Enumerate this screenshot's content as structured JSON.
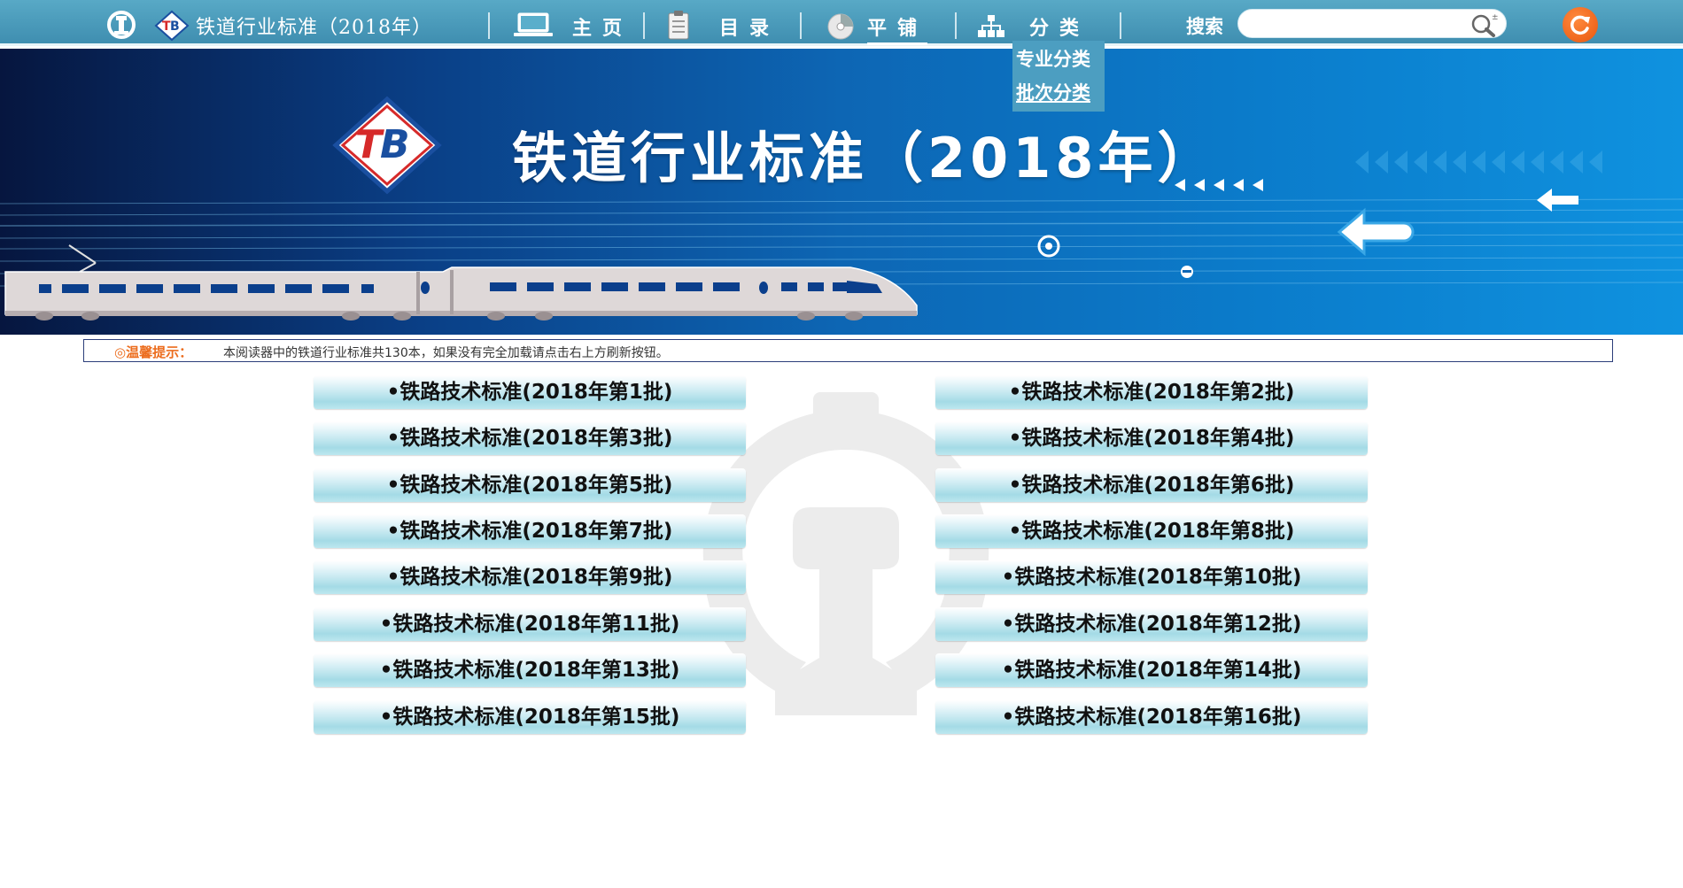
{
  "header": {
    "title": "铁道行业标准（2018年）",
    "nav": [
      {
        "label": "主页",
        "icon": "laptop-icon",
        "active": false
      },
      {
        "label": "目录",
        "icon": "clipboard-icon",
        "active": false
      },
      {
        "label": "平铺",
        "icon": "disc-icon",
        "active": true
      },
      {
        "label": "分类",
        "icon": "hierarchy-icon",
        "active": false
      }
    ],
    "category_menu": [
      "专业分类",
      "批次分类"
    ],
    "search_label": "搜索",
    "search_placeholder": ""
  },
  "banner": {
    "title": "铁道行业标准（2018年）",
    "logo_text": "铁道行业标准"
  },
  "notice": {
    "label": "◎温馨提示：",
    "text": "本阅读器中的铁道行业标准共130本，如果没有完全加载请点击右上方刷新按钮。"
  },
  "batches": [
    "•铁路技术标准(2018年第1批)",
    "•铁路技术标准(2018年第2批)",
    "•铁路技术标准(2018年第3批)",
    "•铁路技术标准(2018年第4批)",
    "•铁路技术标准(2018年第5批)",
    "•铁路技术标准(2018年第6批)",
    "•铁路技术标准(2018年第7批)",
    "•铁路技术标准(2018年第8批)",
    "•铁路技术标准(2018年第9批)",
    "•铁路技术标准(2018年第10批)",
    "•铁路技术标准(2018年第11批)",
    "•铁路技术标准(2018年第12批)",
    "•铁路技术标准(2018年第13批)",
    "•铁路技术标准(2018年第14批)",
    "•铁路技术标准(2018年第15批)",
    "•铁路技术标准(2018年第16批)"
  ],
  "colors": {
    "nav_bar": "#4a9bbd",
    "accent_orange": "#ec6d1e",
    "logo_red": "#d62a2a",
    "logo_blue": "#1a4fa0"
  }
}
